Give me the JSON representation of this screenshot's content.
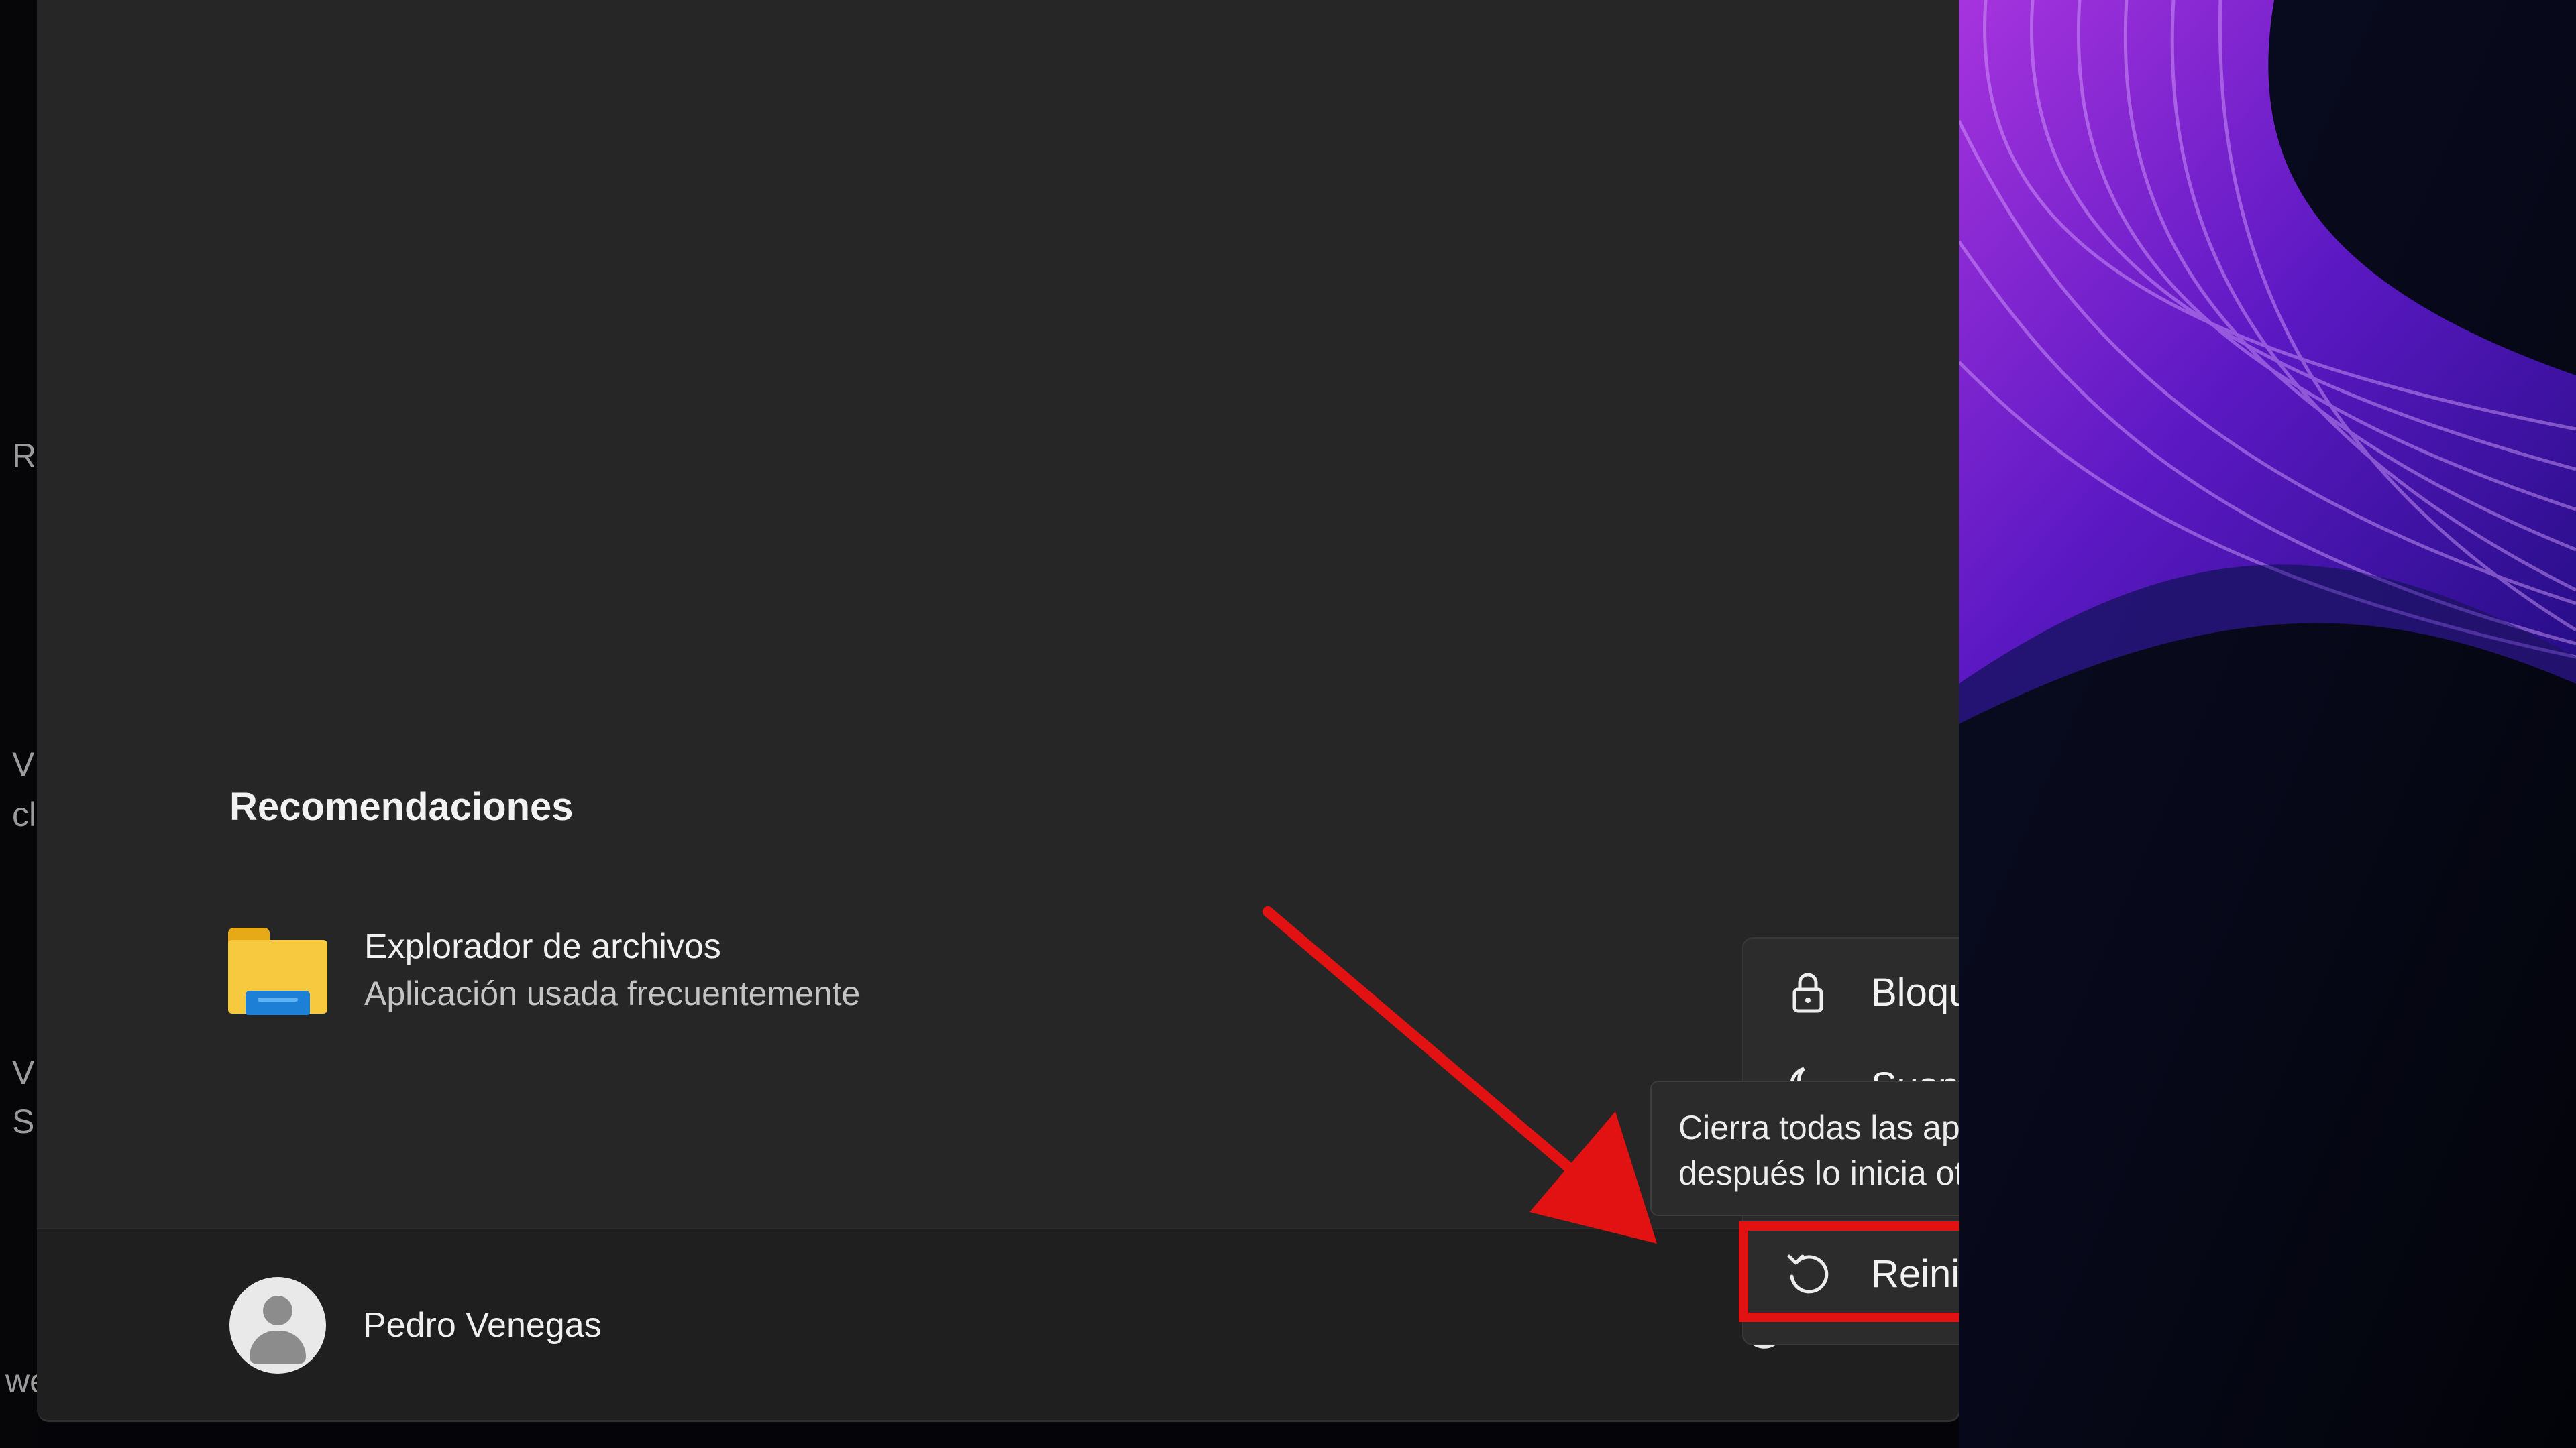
{
  "left_fragments": [
    "R",
    "V",
    "cli",
    "V",
    "S",
    "we"
  ],
  "recommendations": {
    "heading": "Recomendaciones",
    "items": [
      {
        "title": "Explorador de archivos",
        "subtitle": "Aplicación usada frecuentemente",
        "icon": "folder-icon"
      }
    ]
  },
  "user": {
    "name": "Pedro Venegas",
    "avatar_icon": "user-avatar-icon"
  },
  "power_menu": {
    "items": [
      {
        "label": "Bloquear",
        "icon": "lock-icon"
      },
      {
        "label": "Suspender",
        "icon": "moon-icon"
      },
      {
        "label": "Reiniciar",
        "icon": "restart-icon"
      }
    ]
  },
  "tooltip": {
    "line1": "Cierra todas las aplicaciones, apaga el equipo y",
    "line2": "después lo inicia otra vez."
  },
  "colors": {
    "highlight": "#e31212",
    "panel": "#262626",
    "footer": "#1f1f1f",
    "wallpaper_accent": "#8a2be2"
  }
}
